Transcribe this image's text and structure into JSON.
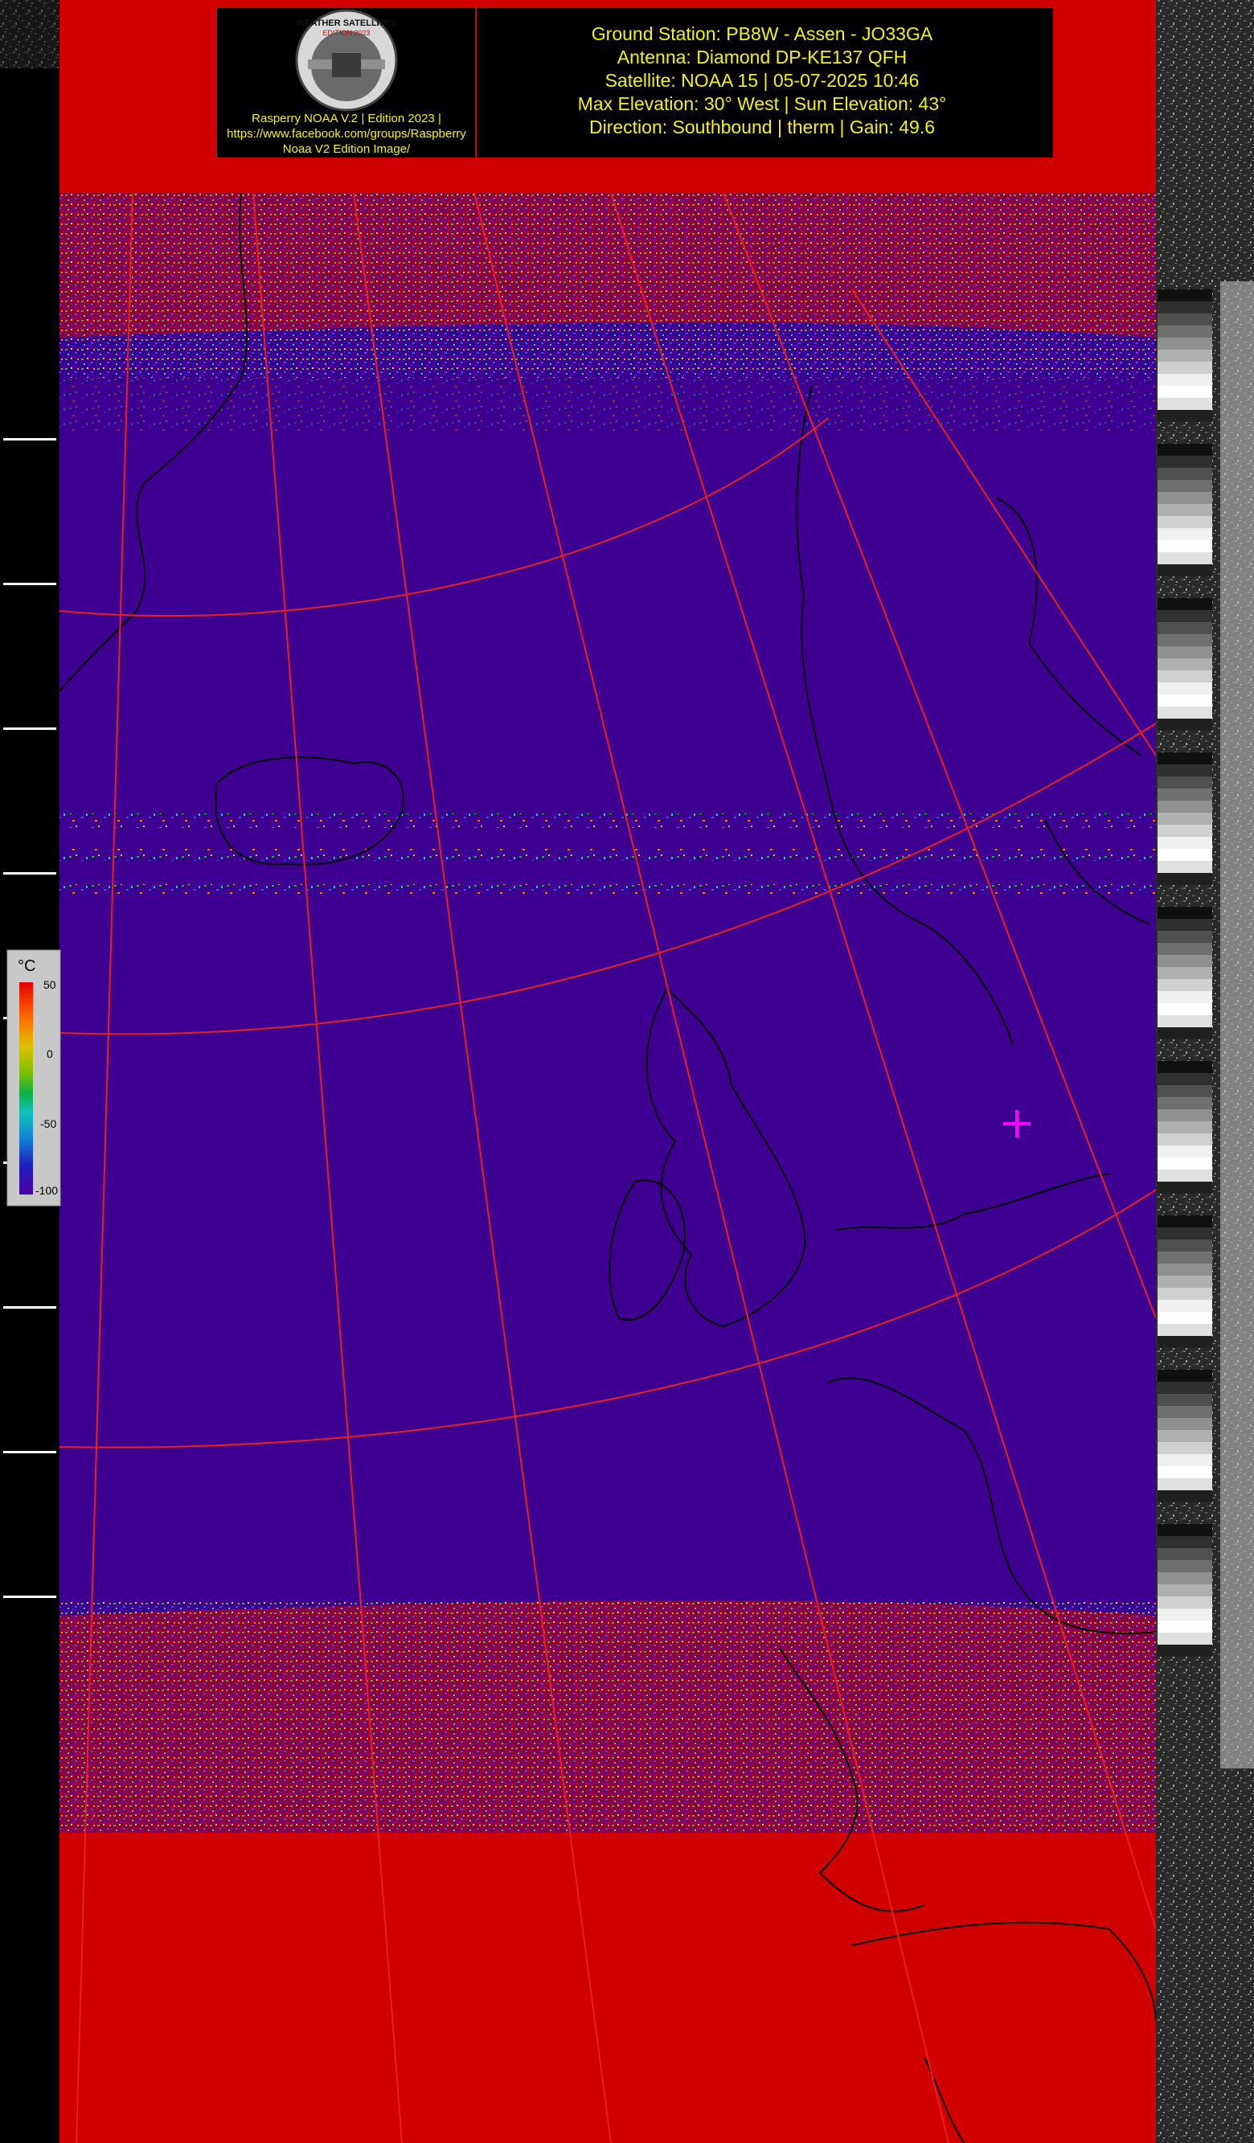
{
  "header": {
    "lines": [
      "Ground Station: PB8W - Assen - JO33GA",
      "Antenna: Diamond DP-KE137 QFH",
      "Satellite: NOAA 15 | 05-07-2025 10:46",
      "Max Elevation: 30° West | Sun Elevation: 43°",
      "Direction: Southbound | therm | Gain: 49.6"
    ]
  },
  "logo": {
    "badge_text": "WEATHER SATELLITES",
    "badge_subtext": "EDITION 2023",
    "caption_lines": [
      "Rasperry NOAA V.2 | Edition 2023 |",
      "https://www.facebook.com/groups/Raspberry",
      "Noaa V2 Edition Image/"
    ]
  },
  "temperature_scale": {
    "unit": "°C",
    "ticks": [
      "50",
      "0",
      "-50",
      "-100"
    ]
  },
  "colors": {
    "hot": "#d00000",
    "cold": "#3d0090",
    "grid": "#e82020",
    "coast": "#000000",
    "marker": "#ff00ff",
    "header_text": "#f2f21a"
  },
  "marker": {
    "label": "ground-station-location"
  }
}
